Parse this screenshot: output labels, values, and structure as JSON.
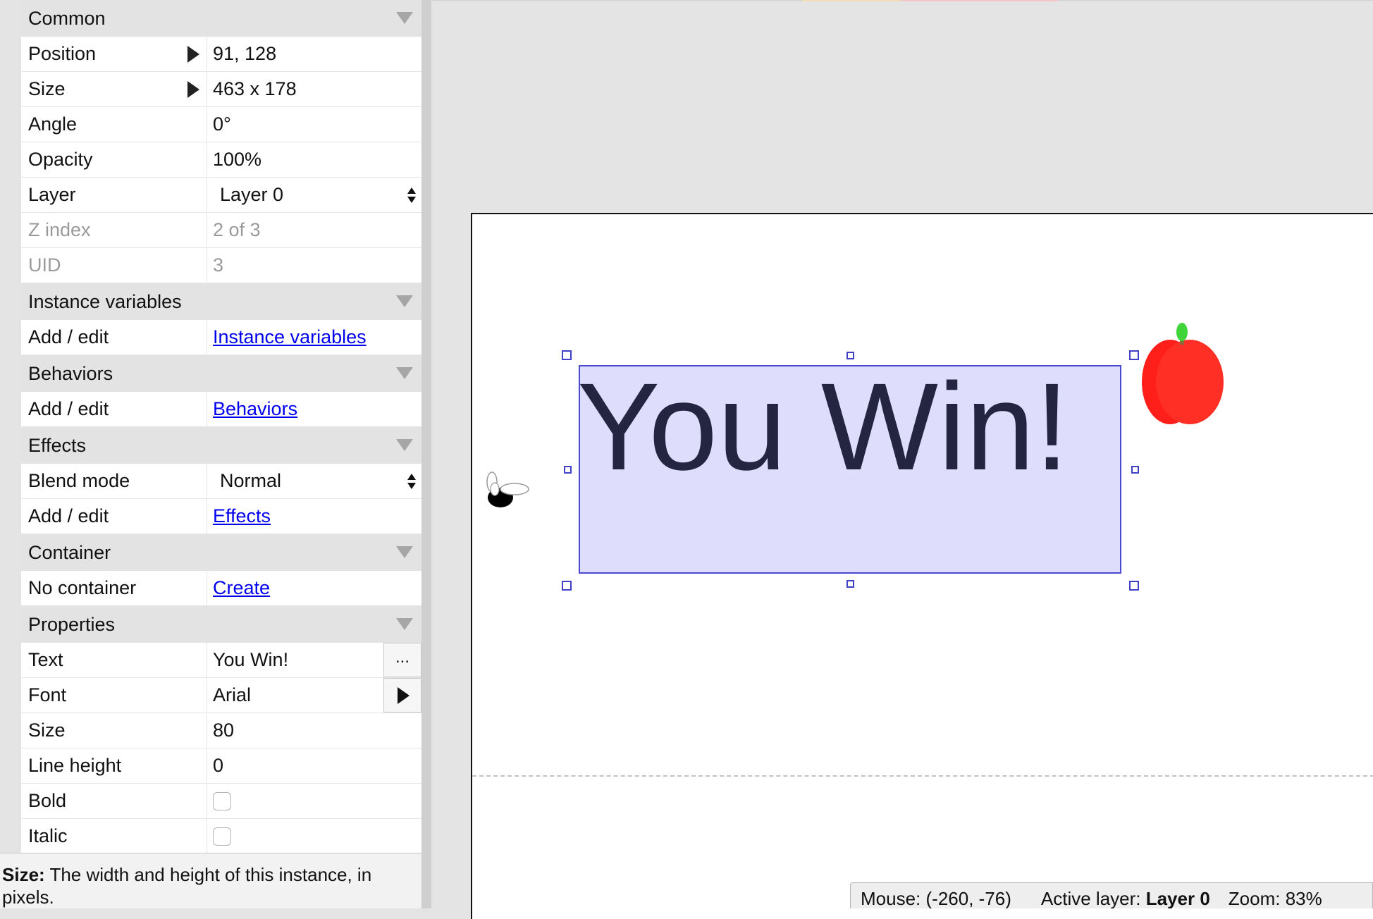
{
  "properties_panel": {
    "groups": {
      "common": "Common",
      "instance_variables": "Instance variables",
      "behaviors": "Behaviors",
      "effects": "Effects",
      "container": "Container",
      "properties": "Properties"
    },
    "common": {
      "position": {
        "label": "Position",
        "value": "91, 128"
      },
      "size": {
        "label": "Size",
        "value": "463 x 178"
      },
      "angle": {
        "label": "Angle",
        "value": "0°"
      },
      "opacity": {
        "label": "Opacity",
        "value": "100%"
      },
      "layer": {
        "label": "Layer",
        "value": "Layer 0"
      },
      "z_index": {
        "label": "Z index",
        "value": "2 of 3"
      },
      "uid": {
        "label": "UID",
        "value": "3"
      }
    },
    "instance_variables": {
      "label": "Add / edit",
      "link": "Instance variables"
    },
    "behaviors": {
      "label": "Add / edit",
      "link": "Behaviors"
    },
    "effects": {
      "blend_mode": {
        "label": "Blend mode",
        "value": "Normal"
      },
      "add_edit": {
        "label": "Add / edit",
        "link": "Effects"
      }
    },
    "container": {
      "label": "No container",
      "link": "Create"
    },
    "properties": {
      "text": {
        "label": "Text",
        "value": "You Win!",
        "button": "..."
      },
      "font": {
        "label": "Font",
        "value": "Arial"
      },
      "size": {
        "label": "Size",
        "value": "80"
      },
      "line_height": {
        "label": "Line height",
        "value": "0"
      },
      "bold": {
        "label": "Bold",
        "checked": false
      },
      "italic": {
        "label": "Italic",
        "checked": false
      }
    }
  },
  "help": {
    "term": "Size:",
    "description": " The width and height of this instance, in pixels."
  },
  "layout": {
    "text_object": "You Win!",
    "objects": [
      "apple-sprite",
      "fly-sprite"
    ]
  },
  "status_bar": {
    "mouse_label": "Mouse: ",
    "mouse_value": "(-260, -76)",
    "active_layer_label": "Active layer: ",
    "active_layer_value": "Layer 0",
    "zoom_label": "Zoom: ",
    "zoom_value": "83%"
  },
  "colors": {
    "selection_fill": "#dedefc",
    "selection_border": "#4a4ad0",
    "text_color": "#232541",
    "link": "#0000ee",
    "apple_red": "#ff2a1f",
    "apple_leaf": "#3ed43a"
  }
}
